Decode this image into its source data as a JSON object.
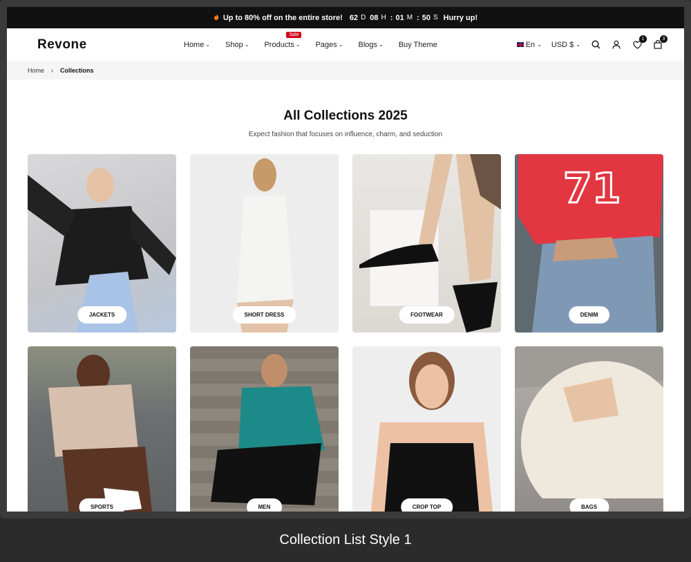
{
  "announcement": {
    "flame_icon": "flame-icon",
    "text": "Up to 80% off on the entire store!",
    "countdown": [
      {
        "value": "62",
        "unit": "D"
      },
      {
        "value": "08",
        "unit": "H"
      },
      {
        "value": "01",
        "unit": "M"
      },
      {
        "value": "50",
        "unit": "S"
      }
    ],
    "separators": [
      ":",
      ":"
    ],
    "cta": "Hurry up!"
  },
  "header": {
    "logo": "Revone",
    "nav": [
      {
        "label": "Home"
      },
      {
        "label": "Shop"
      },
      {
        "label": "Products",
        "badge": "Sale"
      },
      {
        "label": "Pages"
      },
      {
        "label": "Blogs"
      },
      {
        "label": "Buy Theme"
      }
    ],
    "language": "En",
    "currency": "USD $",
    "wishlist_count": "1",
    "cart_count": "3"
  },
  "breadcrumb": {
    "home": "Home",
    "current": "Collections"
  },
  "main": {
    "title": "All Collections 2025",
    "subtitle": "Expect fashion that focuses on influence, charm, and seduction",
    "collections": [
      {
        "label": "JACKETS"
      },
      {
        "label": "SHORT DRESS"
      },
      {
        "label": "FOOTWEAR"
      },
      {
        "label": "DENIM"
      },
      {
        "label": "SPORTS"
      },
      {
        "label": "MEN"
      },
      {
        "label": "CROP TOP"
      },
      {
        "label": "BAGS"
      }
    ]
  },
  "caption": "Collection List Style 1"
}
